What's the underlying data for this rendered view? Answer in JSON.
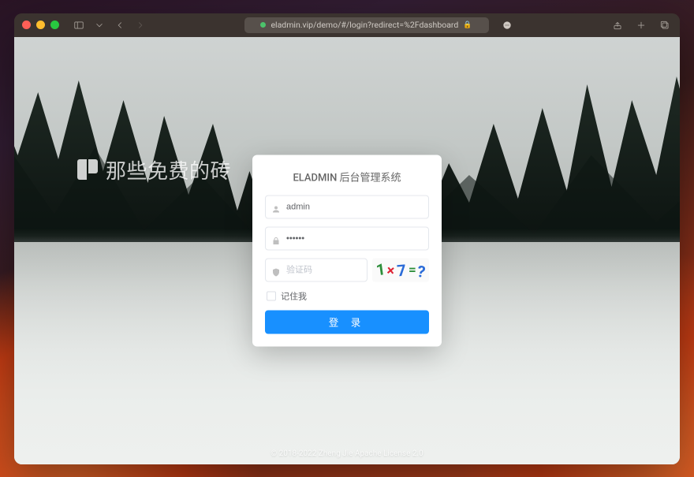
{
  "browser": {
    "url": "eladmin.vip/demo/#/login?redirect=%2Fdashboard"
  },
  "watermark": {
    "text": "那些免费的砖"
  },
  "login": {
    "title": "ELADMIN 后台管理系统",
    "username_value": "admin",
    "password_value": "••••••",
    "captcha_placeholder": "验证码",
    "captcha_display": "1×7=?",
    "remember_label": "记住我",
    "submit_label": "登 录"
  },
  "footer": {
    "text": "© 2018-2022 Zheng Jie Apache License 2.0"
  }
}
